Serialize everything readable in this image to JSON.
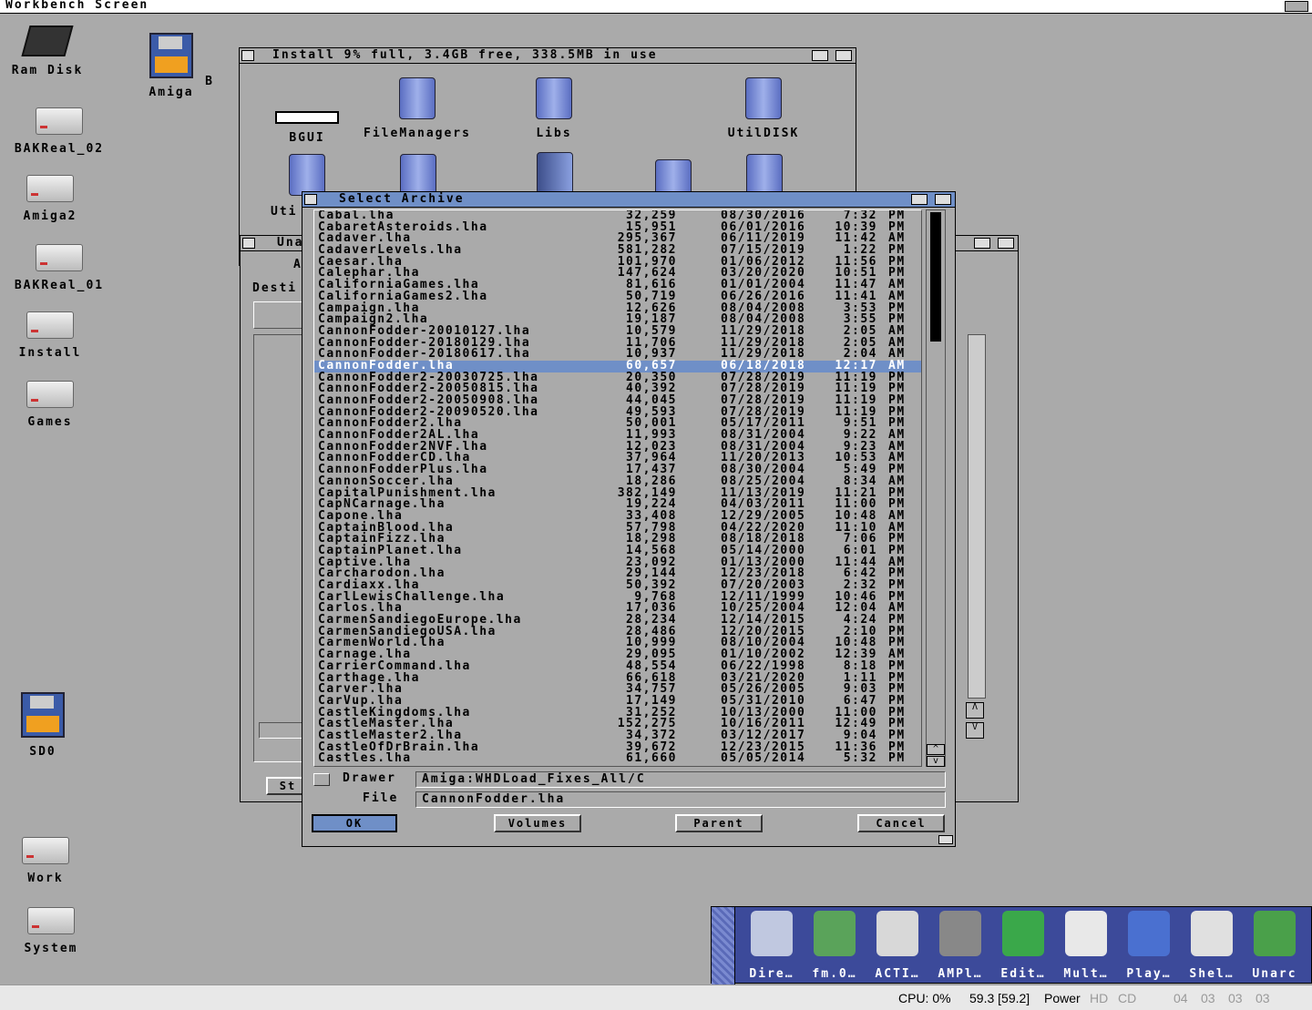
{
  "screen": {
    "title": "Workbench Screen"
  },
  "desktop": {
    "icons": [
      {
        "label": "Ram Disk",
        "icon": "chip-icon"
      },
      {
        "label": "BAKReal_02",
        "icon": "harddisk-icon"
      },
      {
        "label": "Amiga2",
        "icon": "harddisk-icon"
      },
      {
        "label": "BAKReal_01",
        "icon": "harddisk-icon"
      },
      {
        "label": "Install",
        "icon": "harddisk-icon"
      },
      {
        "label": "Games",
        "icon": "harddisk-icon"
      },
      {
        "label": "Amiga",
        "icon": "floppy-icon"
      },
      {
        "label": "B",
        "icon": "drawer-icon"
      },
      {
        "label": "SD0",
        "icon": "floppy-icon"
      },
      {
        "label": "Work",
        "icon": "harddisk-icon"
      },
      {
        "label": "System",
        "icon": "harddisk-icon"
      }
    ]
  },
  "install_window": {
    "title": "Install   9% full, 3.4GB free, 338.5MB  in  use",
    "items": [
      "BGUI",
      "FileManagers",
      "Libs",
      "UtilDISK"
    ],
    "partial": "Uti"
  },
  "unarc_window": {
    "title": "Una",
    "labels": [
      "A",
      "Desti",
      "St"
    ]
  },
  "requester": {
    "title": "Select Archive",
    "files": [
      [
        "Cabal.lha",
        "32,259",
        "08/30/2016",
        "7:32",
        "PM"
      ],
      [
        "CabaretAsteroids.lha",
        "15,951",
        "06/01/2016",
        "10:39",
        "PM"
      ],
      [
        "Cadaver.lha",
        "295,367",
        "06/11/2019",
        "11:42",
        "AM"
      ],
      [
        "CadaverLevels.lha",
        "581,282",
        "07/15/2019",
        "1:22",
        "PM"
      ],
      [
        "Caesar.lha",
        "101,970",
        "01/06/2012",
        "11:56",
        "PM"
      ],
      [
        "Calephar.lha",
        "147,624",
        "03/20/2020",
        "10:51",
        "PM"
      ],
      [
        "CaliforniaGames.lha",
        "81,616",
        "01/01/2004",
        "11:47",
        "AM"
      ],
      [
        "CaliforniaGames2.lha",
        "50,719",
        "06/26/2016",
        "11:41",
        "AM"
      ],
      [
        "Campaign.lha",
        "12,626",
        "08/04/2008",
        "3:53",
        "PM"
      ],
      [
        "Campaign2.lha",
        "19,187",
        "08/04/2008",
        "3:55",
        "PM"
      ],
      [
        "CannonFodder-20010127.lha",
        "10,579",
        "11/29/2018",
        "2:05",
        "AM"
      ],
      [
        "CannonFodder-20180129.lha",
        "11,706",
        "11/29/2018",
        "2:05",
        "AM"
      ],
      [
        "CannonFodder-20180617.lha",
        "10,937",
        "11/29/2018",
        "2:04",
        "AM"
      ],
      [
        "CannonFodder.lha",
        "60,657",
        "06/18/2018",
        "12:17",
        "AM"
      ],
      [
        "CannonFodder2-20030725.lha",
        "20,350",
        "07/28/2019",
        "11:19",
        "PM"
      ],
      [
        "CannonFodder2-20050815.lha",
        "40,392",
        "07/28/2019",
        "11:19",
        "PM"
      ],
      [
        "CannonFodder2-20050908.lha",
        "44,045",
        "07/28/2019",
        "11:19",
        "PM"
      ],
      [
        "CannonFodder2-20090520.lha",
        "49,593",
        "07/28/2019",
        "11:19",
        "PM"
      ],
      [
        "CannonFodder2.lha",
        "50,001",
        "05/17/2011",
        "9:51",
        "PM"
      ],
      [
        "CannonFodder2AL.lha",
        "11,993",
        "08/31/2004",
        "9:22",
        "AM"
      ],
      [
        "CannonFodder2NVF.lha",
        "12,023",
        "08/31/2004",
        "9:23",
        "AM"
      ],
      [
        "CannonFodderCD.lha",
        "37,964",
        "11/20/2013",
        "10:53",
        "AM"
      ],
      [
        "CannonFodderPlus.lha",
        "17,437",
        "08/30/2004",
        "5:49",
        "PM"
      ],
      [
        "CannonSoccer.lha",
        "18,286",
        "08/25/2004",
        "8:34",
        "AM"
      ],
      [
        "CapitalPunishment.lha",
        "382,149",
        "11/13/2019",
        "11:21",
        "PM"
      ],
      [
        "CapNCarnage.lha",
        "19,224",
        "04/03/2011",
        "11:00",
        "PM"
      ],
      [
        "Capone.lha",
        "33,408",
        "12/29/2005",
        "10:48",
        "AM"
      ],
      [
        "CaptainBlood.lha",
        "57,798",
        "04/22/2020",
        "11:10",
        "AM"
      ],
      [
        "CaptainFizz.lha",
        "18,298",
        "08/18/2018",
        "7:06",
        "PM"
      ],
      [
        "CaptainPlanet.lha",
        "14,568",
        "05/14/2000",
        "6:01",
        "PM"
      ],
      [
        "Captive.lha",
        "23,092",
        "01/13/2000",
        "11:44",
        "AM"
      ],
      [
        "Carcharodon.lha",
        "29,144",
        "12/23/2018",
        "6:42",
        "PM"
      ],
      [
        "Cardiaxx.lha",
        "50,392",
        "07/20/2003",
        "2:32",
        "PM"
      ],
      [
        "CarlLewisChallenge.lha",
        "9,768",
        "12/11/1999",
        "10:46",
        "PM"
      ],
      [
        "Carlos.lha",
        "17,036",
        "10/25/2004",
        "12:04",
        "AM"
      ],
      [
        "CarmenSandiegoEurope.lha",
        "28,234",
        "12/14/2015",
        "4:24",
        "PM"
      ],
      [
        "CarmenSandiegoUSA.lha",
        "28,486",
        "12/20/2015",
        "2:10",
        "PM"
      ],
      [
        "CarmenWorld.lha",
        "10,999",
        "08/10/2004",
        "10:48",
        "PM"
      ],
      [
        "Carnage.lha",
        "29,095",
        "01/10/2002",
        "12:39",
        "AM"
      ],
      [
        "CarrierCommand.lha",
        "48,554",
        "06/22/1998",
        "8:18",
        "PM"
      ],
      [
        "Carthage.lha",
        "66,618",
        "03/21/2020",
        "1:11",
        "PM"
      ],
      [
        "Carver.lha",
        "34,757",
        "05/26/2005",
        "9:03",
        "PM"
      ],
      [
        "CarVup.lha",
        "17,149",
        "05/31/2010",
        "6:47",
        "PM"
      ],
      [
        "CastleKingdoms.lha",
        "31,252",
        "10/13/2000",
        "11:00",
        "PM"
      ],
      [
        "CastleMaster.lha",
        "152,275",
        "10/16/2011",
        "12:49",
        "PM"
      ],
      [
        "CastleMaster2.lha",
        "34,372",
        "03/12/2017",
        "9:04",
        "PM"
      ],
      [
        "CastleOfDrBrain.lha",
        "39,672",
        "12/23/2015",
        "11:36",
        "PM"
      ],
      [
        "Castles.lha",
        "61,660",
        "05/05/2014",
        "5:32",
        "PM"
      ]
    ],
    "selected_index": 13,
    "drawer_label": "Drawer",
    "drawer_value": "Amiga:WHDLoad_Fixes_All/C",
    "file_label": "File",
    "file_value": "CannonFodder.lha",
    "ok": "OK",
    "volumes": "Volumes",
    "parent": "Parent",
    "cancel": "Cancel"
  },
  "dock": {
    "items": [
      "Dire…",
      "fm.0…",
      "ACTI…",
      "AMPl…",
      "Edit…",
      "Mult…",
      "Play…",
      "Shel…",
      "Unarc"
    ]
  },
  "status": {
    "cpu": "CPU: 0%",
    "fps": "59.3 [59.2]",
    "power": "Power",
    "hd": "HD",
    "cd": "CD",
    "counters": [
      "04",
      "03",
      "03",
      "03"
    ]
  }
}
